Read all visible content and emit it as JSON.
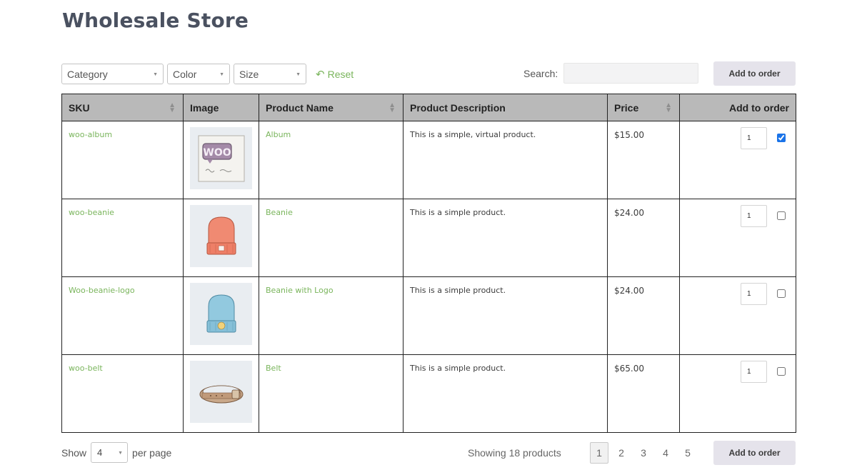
{
  "title": "Wholesale Store",
  "filters": {
    "category": "Category",
    "color": "Color",
    "size": "Size",
    "reset": "Reset"
  },
  "search": {
    "label": "Search:",
    "value": ""
  },
  "add_to_order": "Add to order",
  "table": {
    "headers": [
      "SKU",
      "Image",
      "Product Name",
      "Product Description",
      "Price",
      "Add to order"
    ],
    "rows": [
      {
        "sku": "woo-album",
        "name": "Album",
        "description": "This is a simple, virtual product.",
        "price": "$15.00",
        "qty": "1",
        "checked": true,
        "image": "album-image"
      },
      {
        "sku": "woo-beanie",
        "name": "Beanie",
        "description": "This is a simple product.",
        "price": "$24.00",
        "qty": "1",
        "checked": false,
        "image": "beanie-image"
      },
      {
        "sku": "Woo-beanie-logo",
        "name": "Beanie with Logo",
        "description": "This is a simple product.",
        "price": "$24.00",
        "qty": "1",
        "checked": false,
        "image": "beanie-logo-image"
      },
      {
        "sku": "woo-belt",
        "name": "Belt",
        "description": "This is a simple product.",
        "price": "$65.00",
        "qty": "1",
        "checked": false,
        "image": "belt-image"
      }
    ]
  },
  "footer": {
    "show_label": "Show",
    "per_page_value": "4",
    "per_page_label": "per page",
    "showing": "Showing 18 products",
    "pages": [
      "1",
      "2",
      "3",
      "4",
      "5"
    ],
    "active_page": "1"
  },
  "colors": {
    "accent_green": "#7ab55c",
    "header_bg": "#b9b9b9",
    "button_bg": "#e5e3eb",
    "checkbox_blue": "#1a73e8"
  }
}
